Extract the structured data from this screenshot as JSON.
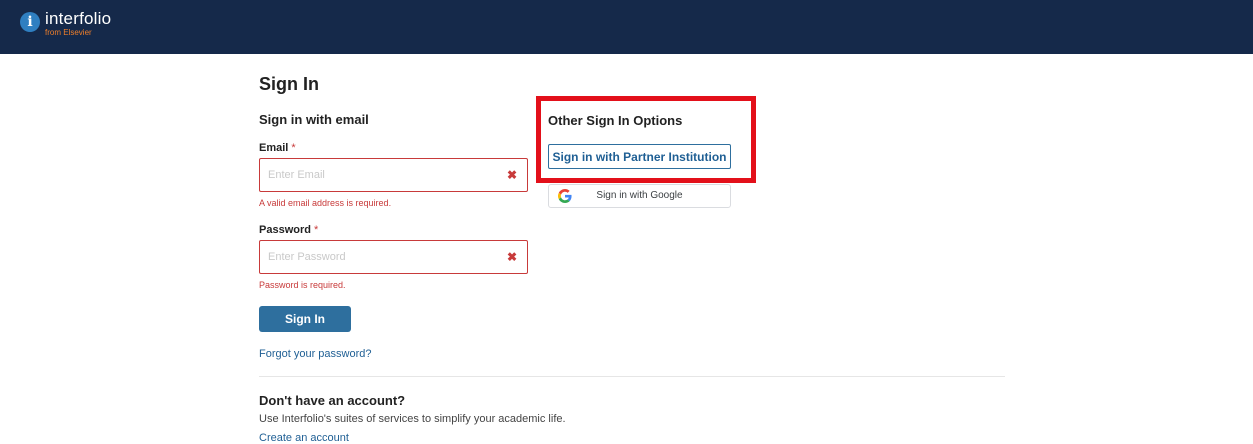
{
  "header": {
    "brand_name": "interfolio",
    "brand_sub": "from Elsevier",
    "logo_glyph": "i"
  },
  "page": {
    "title": "Sign In"
  },
  "email_section": {
    "title": "Sign in with email",
    "email_label": "Email",
    "required_marker": "*",
    "email_placeholder": "Enter Email",
    "email_value": "",
    "email_error": "A valid email address is required.",
    "password_label": "Password",
    "password_placeholder": "Enter Password",
    "password_value": "",
    "password_error": "Password is required.",
    "clear_glyph": "✖",
    "submit_label": "Sign In",
    "forgot_link": "Forgot your password?"
  },
  "other_options": {
    "title": "Other Sign In Options",
    "partner_button": "Sign in with Partner Institution",
    "google_button": "Sign in with Google"
  },
  "signup": {
    "title": "Don't have an account?",
    "description": "Use Interfolio's suites of services to simplify your academic life.",
    "create_link": "Create an account"
  },
  "colors": {
    "header_bg": "#15294a",
    "primary": "#2e6f9e",
    "error": "#c83a3a",
    "highlight": "#e3101a"
  },
  "icons": [
    "interfolio-logo-icon",
    "clear-email-icon",
    "clear-password-icon",
    "google-icon"
  ]
}
